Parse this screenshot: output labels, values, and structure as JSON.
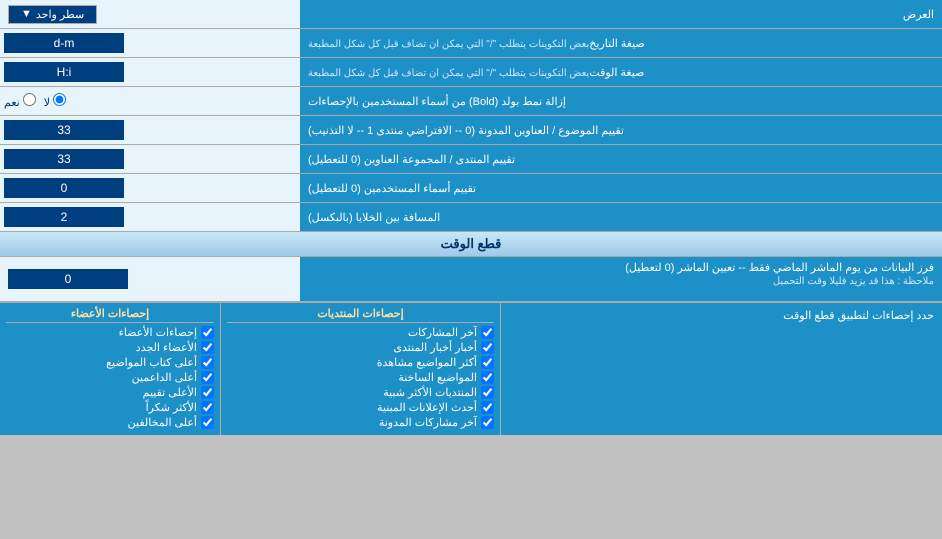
{
  "header": {
    "label": "العرض",
    "dropdown_label": "سطر واحد",
    "dropdown_icon": "▼"
  },
  "rows": [
    {
      "id": "date_format",
      "label": "صيغة التاريخ",
      "sublabel": "بعض التكوينات يتطلب \"/\" التي يمكن ان تضاف قبل كل شكل المطبعة",
      "value": "d-m",
      "type": "input"
    },
    {
      "id": "time_format",
      "label": "صيغة الوقت",
      "sublabel": "بعض التكوينات يتطلب \"/\" التي يمكن ان تضاف قبل كل شكل المطبعة",
      "value": "H:i",
      "type": "input"
    },
    {
      "id": "bold_remove",
      "label": "إزالة نمط بولد (Bold) من أسماء المستخدمين بالإحصاءات",
      "radio_yes": "نعم",
      "radio_no": "لا",
      "selected": "no",
      "type": "radio"
    },
    {
      "id": "topic_titles",
      "label": "تقييم الموضوع / العناوين المدونة (0 -- الافتراضي منتدى 1 -- لا التذنيب)",
      "value": "33",
      "type": "input"
    },
    {
      "id": "forum_group",
      "label": "تقييم المنتدى / المجموعة العناوين (0 للتعطيل)",
      "value": "33",
      "type": "input"
    },
    {
      "id": "user_names",
      "label": "تقييم أسماء المستخدمين (0 للتعطيل)",
      "value": "0",
      "type": "input"
    },
    {
      "id": "cell_spacing",
      "label": "المسافة بين الخلايا (بالبكسل)",
      "value": "2",
      "type": "input"
    }
  ],
  "cut_time_section": {
    "header": "قطع الوقت",
    "row": {
      "label": "فرز البيانات من يوم الماشر الماضي فقط -- تعيين الماشر (0 لتعطيل)",
      "sublabel": "ملاحظة : هذا قد يزيد قليلا وقت التحميل",
      "value": "0"
    },
    "limit_label": "حدد إحصاءات لتطبيق قطع الوقت"
  },
  "checkboxes": {
    "middle_header": "إحصاءات المنتديات",
    "left_header": "إحصاءات الأعضاء",
    "middle_items": [
      {
        "label": "آخر المشاركات",
        "checked": true
      },
      {
        "label": "أخبار أخبار المنتدى",
        "checked": true
      },
      {
        "label": "أكثر المواضيع مشاهدة",
        "checked": true
      },
      {
        "label": "المواضيع الساخنة",
        "checked": true
      },
      {
        "label": "المنتديات الأكثر شبية",
        "checked": true
      },
      {
        "label": "أحدث الإعلانات المبنية",
        "checked": true
      },
      {
        "label": "آخر مشاركات المدونة",
        "checked": true
      }
    ],
    "left_items": [
      {
        "label": "إحصاءات الأعضاء",
        "checked": true
      },
      {
        "label": "الأعضاء الجدد",
        "checked": true
      },
      {
        "label": "أعلى كتاب المواضيع",
        "checked": true
      },
      {
        "label": "أعلى الداعمين",
        "checked": true
      },
      {
        "label": "الأعلى تقييم",
        "checked": true
      },
      {
        "label": "الأكثر شكراً",
        "checked": true
      },
      {
        "label": "أعلى المخالفين",
        "checked": true
      }
    ]
  },
  "colors": {
    "header_bg": "#1e90c8",
    "input_bg": "#003f7f",
    "row_bg": "#e8f4fc",
    "section_header_bg": "#a8d4f0",
    "text_light": "#ffffff",
    "text_dark": "#003366"
  }
}
